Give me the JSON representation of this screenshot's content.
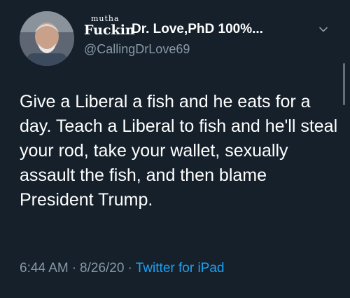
{
  "author": {
    "name_prefix": "Fuckin",
    "name_superscript": "mutha",
    "display_name": "Dr. Love,PhD 100%...",
    "handle": "@CallingDrLove69"
  },
  "tweet": {
    "text": "Give a Liberal a fish and he eats for a day. Teach a Liberal to fish and he'll steal your rod, take your wallet, sexually assault the fish, and then blame President Trump.",
    "time": "6:44 AM",
    "date": "8/26/20",
    "separator": "·",
    "source": "Twitter for iPad"
  },
  "icons": {
    "avatar": "profile-photo",
    "menu": "chevron-down-icon"
  },
  "colors": {
    "background": "#15202b",
    "text": "#ffffff",
    "secondary": "#8899a6",
    "link": "#1da1f2"
  }
}
